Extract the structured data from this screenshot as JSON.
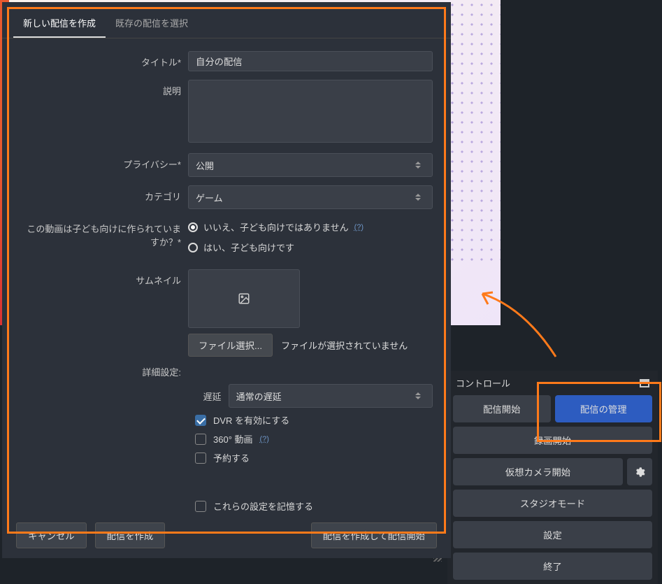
{
  "tabs": {
    "create": "新しい配信を作成",
    "existing": "既存の配信を選択"
  },
  "form": {
    "title_label": "タイトル*",
    "title_value": "自分の配信",
    "desc_label": "説明",
    "privacy_label": "プライバシー*",
    "privacy_value": "公開",
    "category_label": "カテゴリ",
    "category_value": "ゲーム",
    "kids_label": "この動画は子ども向けに作られていますか？*",
    "kids_no": "いいえ、子ども向けではありません",
    "kids_yes": "はい、子ども向けです",
    "help": "(?)",
    "thumb_label": "サムネイル",
    "file_btn": "ファイル選択...",
    "file_status": "ファイルが選択されていません",
    "adv_label": "詳細設定:",
    "latency_label": "遅延",
    "latency_value": "通常の遅延",
    "dvr": "DVR を有効にする",
    "video360": "360° 動画",
    "schedule": "予約する",
    "remember": "これらの設定を記憶する"
  },
  "footer": {
    "cancel": "キャンセル",
    "create": "配信を作成",
    "create_start": "配信を作成して配信開始"
  },
  "control": {
    "header": "コントロール",
    "start_stream": "配信開始",
    "manage_stream": "配信の管理",
    "start_record": "録画開始",
    "start_vcam": "仮想カメラ開始",
    "studio": "スタジオモード",
    "settings": "設定",
    "exit": "終了"
  }
}
